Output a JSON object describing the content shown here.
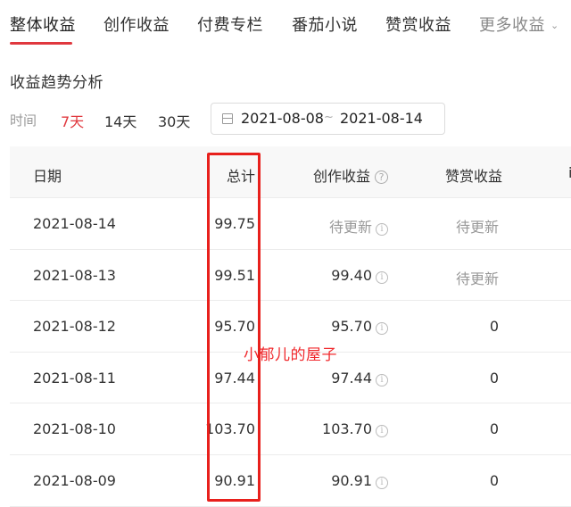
{
  "tabs": [
    {
      "label": "整体收益",
      "active": true
    },
    {
      "label": "创作收益",
      "active": false
    },
    {
      "label": "付费专栏",
      "active": false
    },
    {
      "label": "番茄小说",
      "active": false
    },
    {
      "label": "赞赏收益",
      "active": false
    },
    {
      "label": "更多收益",
      "active": false,
      "has_dropdown": true
    }
  ],
  "section_title": "收益趋势分析",
  "filter": {
    "label": "时间",
    "ranges": [
      {
        "label": "7天",
        "active": true
      },
      {
        "label": "14天",
        "active": false
      },
      {
        "label": "30天",
        "active": false
      }
    ],
    "date_start": "2021-08-08",
    "date_separator": "~",
    "date_end": "2021-08-14"
  },
  "table": {
    "headers": {
      "date": "日期",
      "total": "总计",
      "creation": "创作收益",
      "reward": "赞赏收益",
      "extra_partial": "i"
    },
    "help_icon": "?",
    "info_icon": "i",
    "rows": [
      {
        "date": "2021-08-14",
        "total": "99.75",
        "creation": "待更新",
        "reward": "待更新"
      },
      {
        "date": "2021-08-13",
        "total": "99.51",
        "creation": "99.40",
        "reward": "待更新"
      },
      {
        "date": "2021-08-12",
        "total": "95.70",
        "creation": "95.70",
        "reward": "0"
      },
      {
        "date": "2021-08-11",
        "total": "97.44",
        "creation": "97.44",
        "reward": "0"
      },
      {
        "date": "2021-08-10",
        "total": "103.70",
        "creation": "103.70",
        "reward": "0"
      },
      {
        "date": "2021-08-09",
        "total": "90.91",
        "creation": "90.91",
        "reward": "0"
      }
    ]
  },
  "annotation": {
    "watermark": "小郁儿的屋子",
    "highlight_color": "#e8201c"
  },
  "colors": {
    "accent": "#e0383e",
    "pending_text": "#999999"
  }
}
